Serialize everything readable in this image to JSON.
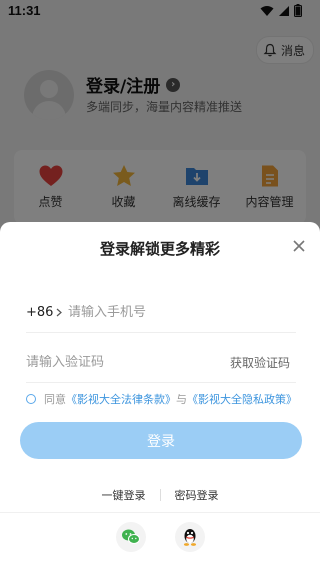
{
  "status_bar": {
    "time": "11:31"
  },
  "header": {
    "messages_label": "消息"
  },
  "profile": {
    "title": "登录/注册",
    "subtitle": "多端同步，海量内容精准推送"
  },
  "quick_actions": [
    {
      "label": "点赞",
      "icon": "heart-icon"
    },
    {
      "label": "收藏",
      "icon": "star-icon"
    },
    {
      "label": "离线缓存",
      "icon": "download-folder-icon"
    },
    {
      "label": "内容管理",
      "icon": "document-icon"
    }
  ],
  "login_sheet": {
    "title": "登录解锁更多精彩",
    "country_code": "+86",
    "phone_placeholder": "请输入手机号",
    "code_placeholder": "请输入验证码",
    "get_code_label": "获取验证码",
    "agree_prefix": "同意",
    "terms_link": "《影视大全法律条款》",
    "agree_and": "与",
    "privacy_link": "《影视大全隐私政策》",
    "login_button": "登录",
    "one_click_login": "一键登录",
    "password_login": "密码登录"
  },
  "colors": {
    "accent": "#3d95de",
    "button_disabled": "#9bcdf5",
    "overlay": "rgba(0,0,0,0.5)"
  }
}
